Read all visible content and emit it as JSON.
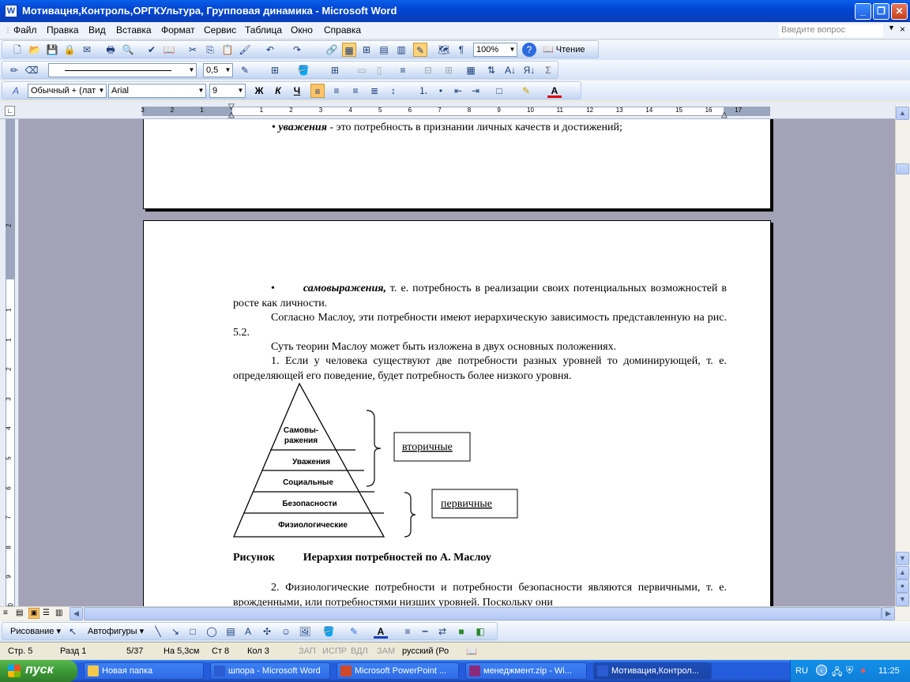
{
  "window": {
    "title": "Мотивацня,Контроль,ОРГКУльтура, Групповая динамика - Microsoft Word",
    "icon": "word-icon"
  },
  "menu": {
    "items": [
      "Файл",
      "Правка",
      "Вид",
      "Вставка",
      "Формат",
      "Сервис",
      "Таблица",
      "Окно",
      "Справка"
    ],
    "ask_placeholder": "Введите вопрос"
  },
  "toolbar": {
    "zoom": "100%",
    "reading_label": "Чтение",
    "line_weight": "0,5",
    "style": "Обычный + (лат",
    "font": "Arial",
    "size": "9",
    "bold": "Ж",
    "italic": "К",
    "underline": "Ч",
    "pilcrow": "¶",
    "sum": "Σ"
  },
  "ruler": {
    "numbers": [
      "3",
      "2",
      "1",
      "1",
      "2",
      "3",
      "4",
      "5",
      "6",
      "7",
      "8",
      "9",
      "10",
      "11",
      "12",
      "13",
      "14",
      "15",
      "16",
      "17"
    ],
    "vnumbers": [
      "2",
      "1",
      "1",
      "2",
      "3",
      "4",
      "5",
      "6",
      "7",
      "8",
      "9",
      "10"
    ]
  },
  "document": {
    "page1": {
      "bullet": "•",
      "term": "уважения",
      "text": " - это потребность в признании личных качеств и достижений;"
    },
    "page2": {
      "bullet": "•",
      "term": "самовыражения,",
      "text1_rest": " т. е. потребность в реализации своих потенциальных возможностей в росте как личности.",
      "para2": "Согласно Маслоу, эти потребности имеют иерархическую зависимость представленную на рис. 5.2.",
      "para3": "Суть теории Маслоу может быть изложена в двух основных положениях.",
      "para4": "1. Если у человека существуют две потребности разных уровней то доминирующей, т. е. определяющей его поведение, будет потребность более низкого уровня.",
      "figure_caption_label": "Рисунок",
      "figure_caption_text": "Иерархия потребностей по А. Маслоу",
      "para5": "2. Физиологические потребности и потребности безопасности являются первичными, т. е. врожденными, или потребностями низших уровней. Поскольку они"
    },
    "pyramid": {
      "levels": [
        "Самовы-",
        "ражения",
        "Уважения",
        "Социальные",
        "Безопасности",
        "Физиологические"
      ],
      "secondary": "вторичные",
      "primary": "первичные"
    }
  },
  "drawing_toolbar": {
    "drawing": "Рисование",
    "autoshapes": "Автофигуры"
  },
  "status": {
    "page": "Стр. 5",
    "section": "Разд 1",
    "pages": "5/37",
    "at": "На 5,3см",
    "line": "Ст 8",
    "col": "Кол 3",
    "rec": "ЗАП",
    "trk": "ИСПР",
    "ext": "ВДЛ",
    "ovr": "ЗАМ",
    "lang": "русский (Ро"
  },
  "taskbar": {
    "start": "пуск",
    "tasks": [
      {
        "label": "Новая папка",
        "icon": "folder-icon",
        "color": "#F2C94C"
      },
      {
        "label": "шпора - Microsoft Word",
        "icon": "word-icon",
        "color": "#2B5CD1"
      },
      {
        "label": "Microsoft PowerPoint ...",
        "icon": "powerpoint-icon",
        "color": "#D24726"
      },
      {
        "label": "менеджмент.zip - Wi...",
        "icon": "winrar-icon",
        "color": "#8B2A7A"
      },
      {
        "label": "Мотивация,Контрол...",
        "icon": "word-icon",
        "color": "#2B5CD1"
      }
    ],
    "lang": "RU",
    "clock": "11:25"
  }
}
